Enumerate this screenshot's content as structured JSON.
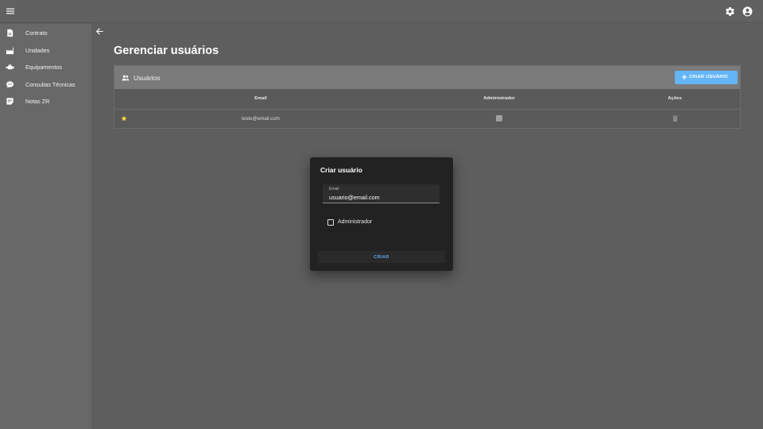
{
  "topbar": {
    "menu_icon": "menu-icon",
    "settings_icon": "gear-icon",
    "account_icon": "account-circle-icon"
  },
  "sidebar": {
    "items": [
      {
        "label": "Contrato",
        "icon": "document-icon"
      },
      {
        "label": "Unidades",
        "icon": "factory-icon"
      },
      {
        "label": "Equipamentos",
        "icon": "equipment-icon"
      },
      {
        "label": "Consultas Técnicas",
        "icon": "chat-bubble-icon"
      },
      {
        "label": "Notas ZR",
        "icon": "note-icon"
      }
    ]
  },
  "page": {
    "title": "Gerenciar usuários"
  },
  "users_card": {
    "title": "Usuários",
    "create_button": "CRIAR USUÁRIO",
    "columns": [
      "Email",
      "Administrador",
      "Ações"
    ],
    "rows": [
      {
        "email": "teste@email.com",
        "starred": true,
        "administrator": true
      }
    ]
  },
  "dialog": {
    "title": "Criar usuário",
    "email_label": "Email",
    "email_value": "usuario@email.com",
    "admin_label": "Administrador",
    "admin_checked": false,
    "submit_label": "CRIAR"
  },
  "colors": {
    "accent": "#64b5f6",
    "star": "#fdd835",
    "dialog_bg": "#222222"
  }
}
